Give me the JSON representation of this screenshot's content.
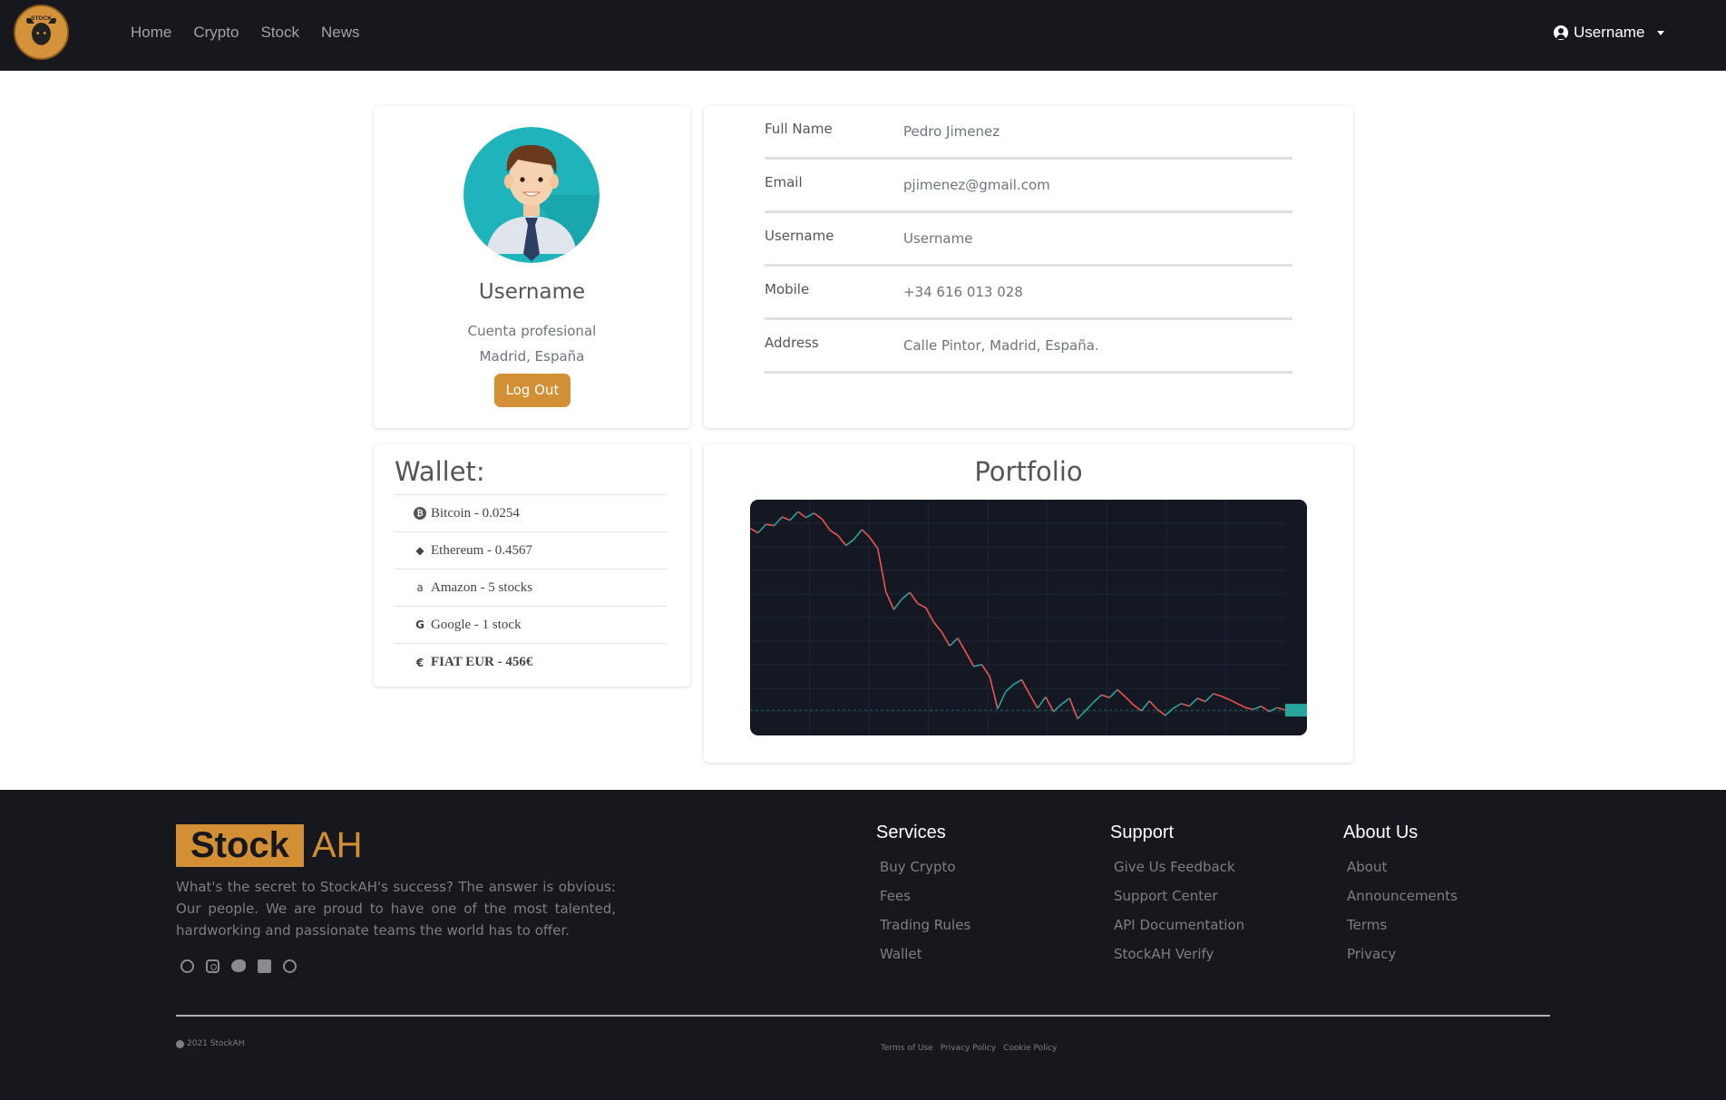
{
  "navbar": {
    "logo_text": "STOCK",
    "links": [
      "Home",
      "Crypto",
      "Stock",
      "News"
    ],
    "user_label": "Username"
  },
  "profile": {
    "name": "Username",
    "account_type": "Cuenta profesional",
    "location": "Madrid, España",
    "logout_label": "Log Out"
  },
  "info": {
    "rows": [
      {
        "label": "Full Name",
        "value": "Pedro Jimenez"
      },
      {
        "label": "Email",
        "value": "pjimenez@gmail.com"
      },
      {
        "label": "Username",
        "value": "Username"
      },
      {
        "label": "Mobile",
        "value": "+34 616 013 028"
      },
      {
        "label": "Address",
        "value": "Calle Pintor, Madrid, España."
      }
    ]
  },
  "wallet": {
    "title": "Wallet:",
    "items": [
      {
        "icon": "bitcoin-icon",
        "text": "Bitcoin - 0.0254"
      },
      {
        "icon": "ethereum-icon",
        "text": "Ethereum - 0.4567"
      },
      {
        "icon": "amazon-icon",
        "text": "Amazon - 5 stocks"
      },
      {
        "icon": "google-icon",
        "text": "Google - 1 stock"
      },
      {
        "icon": "euro-icon",
        "text": "FIAT EUR - 456€"
      }
    ]
  },
  "portfolio": {
    "title": "Portfolio"
  },
  "chart_data": {
    "type": "line",
    "title": "",
    "xlabel": "",
    "ylabel": "",
    "y": [
      58.5,
      57.8,
      59.1,
      58.9,
      60.2,
      59.7,
      61.0,
      60.1,
      60.8,
      59.9,
      58.2,
      57.4,
      55.9,
      56.8,
      58.3,
      57.1,
      55.4,
      48.9,
      46.2,
      47.8,
      48.8,
      47.1,
      46.5,
      44.3,
      42.8,
      40.7,
      41.9,
      39.8,
      37.6,
      37.9,
      36.1,
      31.2,
      33.8,
      34.9,
      35.6,
      33.4,
      31.3,
      33.0,
      30.8,
      31.9,
      32.8,
      29.7,
      30.9,
      32.2,
      33.3,
      32.9,
      34.1,
      33.0,
      31.8,
      30.9,
      32.4,
      31.1,
      30.2,
      31.3,
      32.0,
      31.6,
      32.8,
      32.3,
      33.5,
      33.1,
      32.6,
      32.0,
      31.4,
      31.1,
      31.6,
      30.8,
      31.4,
      31.0
    ],
    "ylim": [
      28,
      62
    ],
    "grid": true,
    "colors": {
      "up": "#26a69a",
      "down": "#ef5350",
      "background": "#141823"
    }
  },
  "footer": {
    "brand_box": "Stock",
    "brand_rest": "AH",
    "description": "What's the secret to StockAH's success? The answer is obvious: Our people. We are proud to have one of the most talented, hardworking and passionate teams the world has to offer.",
    "columns": [
      {
        "title": "Services",
        "links": [
          "Buy Crypto",
          "Fees",
          "Trading Rules",
          "Wallet"
        ]
      },
      {
        "title": "Support",
        "links": [
          "Give Us Feedback",
          "Support Center",
          "API Documentation",
          "StockAH Verify"
        ]
      },
      {
        "title": "About Us",
        "links": [
          "About",
          "Announcements",
          "Terms",
          "Privacy"
        ]
      }
    ],
    "copyright": "2021 StockAH",
    "legal_links": [
      "Terms of Use",
      "Privacy Policy",
      "Cookie Policy"
    ]
  }
}
